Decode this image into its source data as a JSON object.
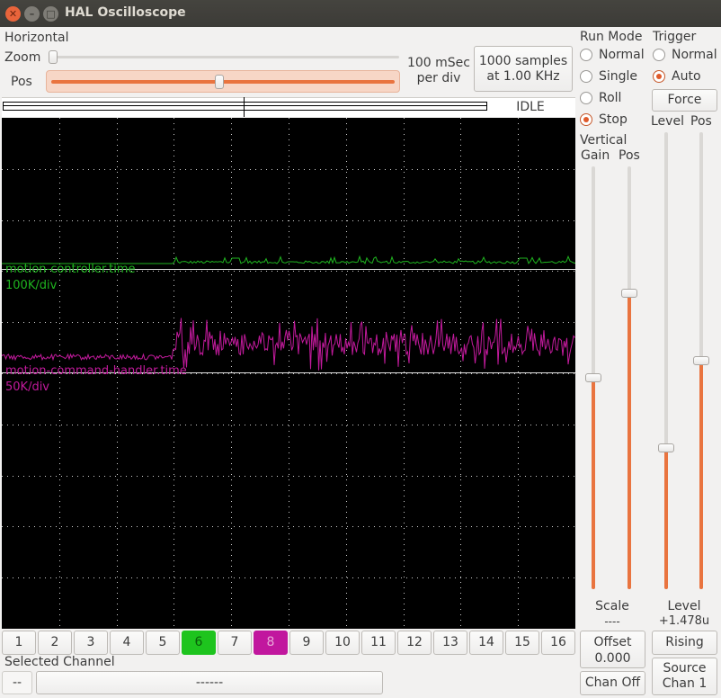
{
  "window": {
    "title": "HAL Oscilloscope"
  },
  "horizontal": {
    "group_label": "Horizontal",
    "zoom_label": "Zoom",
    "pos_label": "Pos",
    "zoom_level": 0.0,
    "pos_level": 0.49,
    "time_per_div_line1": "100 mSec",
    "time_per_div_line2": "per div",
    "samples_line1": "1000 samples",
    "samples_line2": "at 1.00 KHz",
    "status": "IDLE"
  },
  "run_mode": {
    "group_label": "Run Mode",
    "options": [
      {
        "label": "Normal",
        "selected": false
      },
      {
        "label": "Single",
        "selected": false
      },
      {
        "label": "Roll",
        "selected": false
      },
      {
        "label": "Stop",
        "selected": true
      }
    ]
  },
  "trigger": {
    "group_label": "Trigger",
    "options": [
      {
        "label": "Normal",
        "selected": false
      },
      {
        "label": "Auto",
        "selected": true
      }
    ],
    "force_label": "Force",
    "level_label": "Level",
    "pos_label": "Pos",
    "level_value_label": "Level",
    "level_value": "+1.478u",
    "edge_button": "Rising",
    "source_line1": "Source",
    "source_line2": "Chan 1",
    "level_slider": 0.31,
    "pos_slider": 0.5
  },
  "vertical": {
    "group_label": "Vertical",
    "gain_label": "Gain",
    "pos_label": "Pos",
    "scale_label": "Scale",
    "scale_value": "----",
    "offset_line1": "Offset",
    "offset_line2": "0.000",
    "chan_off_label": "Chan Off",
    "gain_slider": 0.5,
    "pos_slider": 0.7
  },
  "traces": [
    {
      "name": "motion-controller.time",
      "scale": "100K/div",
      "color": "#1fb41f"
    },
    {
      "name": "motion-command-handler.time",
      "scale": "50K/div",
      "color": "#c21a9c"
    }
  ],
  "channels": [
    "1",
    "2",
    "3",
    "4",
    "5",
    "6",
    "7",
    "8",
    "9",
    "10",
    "11",
    "12",
    "13",
    "14",
    "15",
    "16"
  ],
  "channel_colors": {
    "6": "#1ec41e",
    "8": "#c1179e"
  },
  "selected_channel": {
    "label": "Selected Channel",
    "left": "--",
    "right": "------"
  }
}
